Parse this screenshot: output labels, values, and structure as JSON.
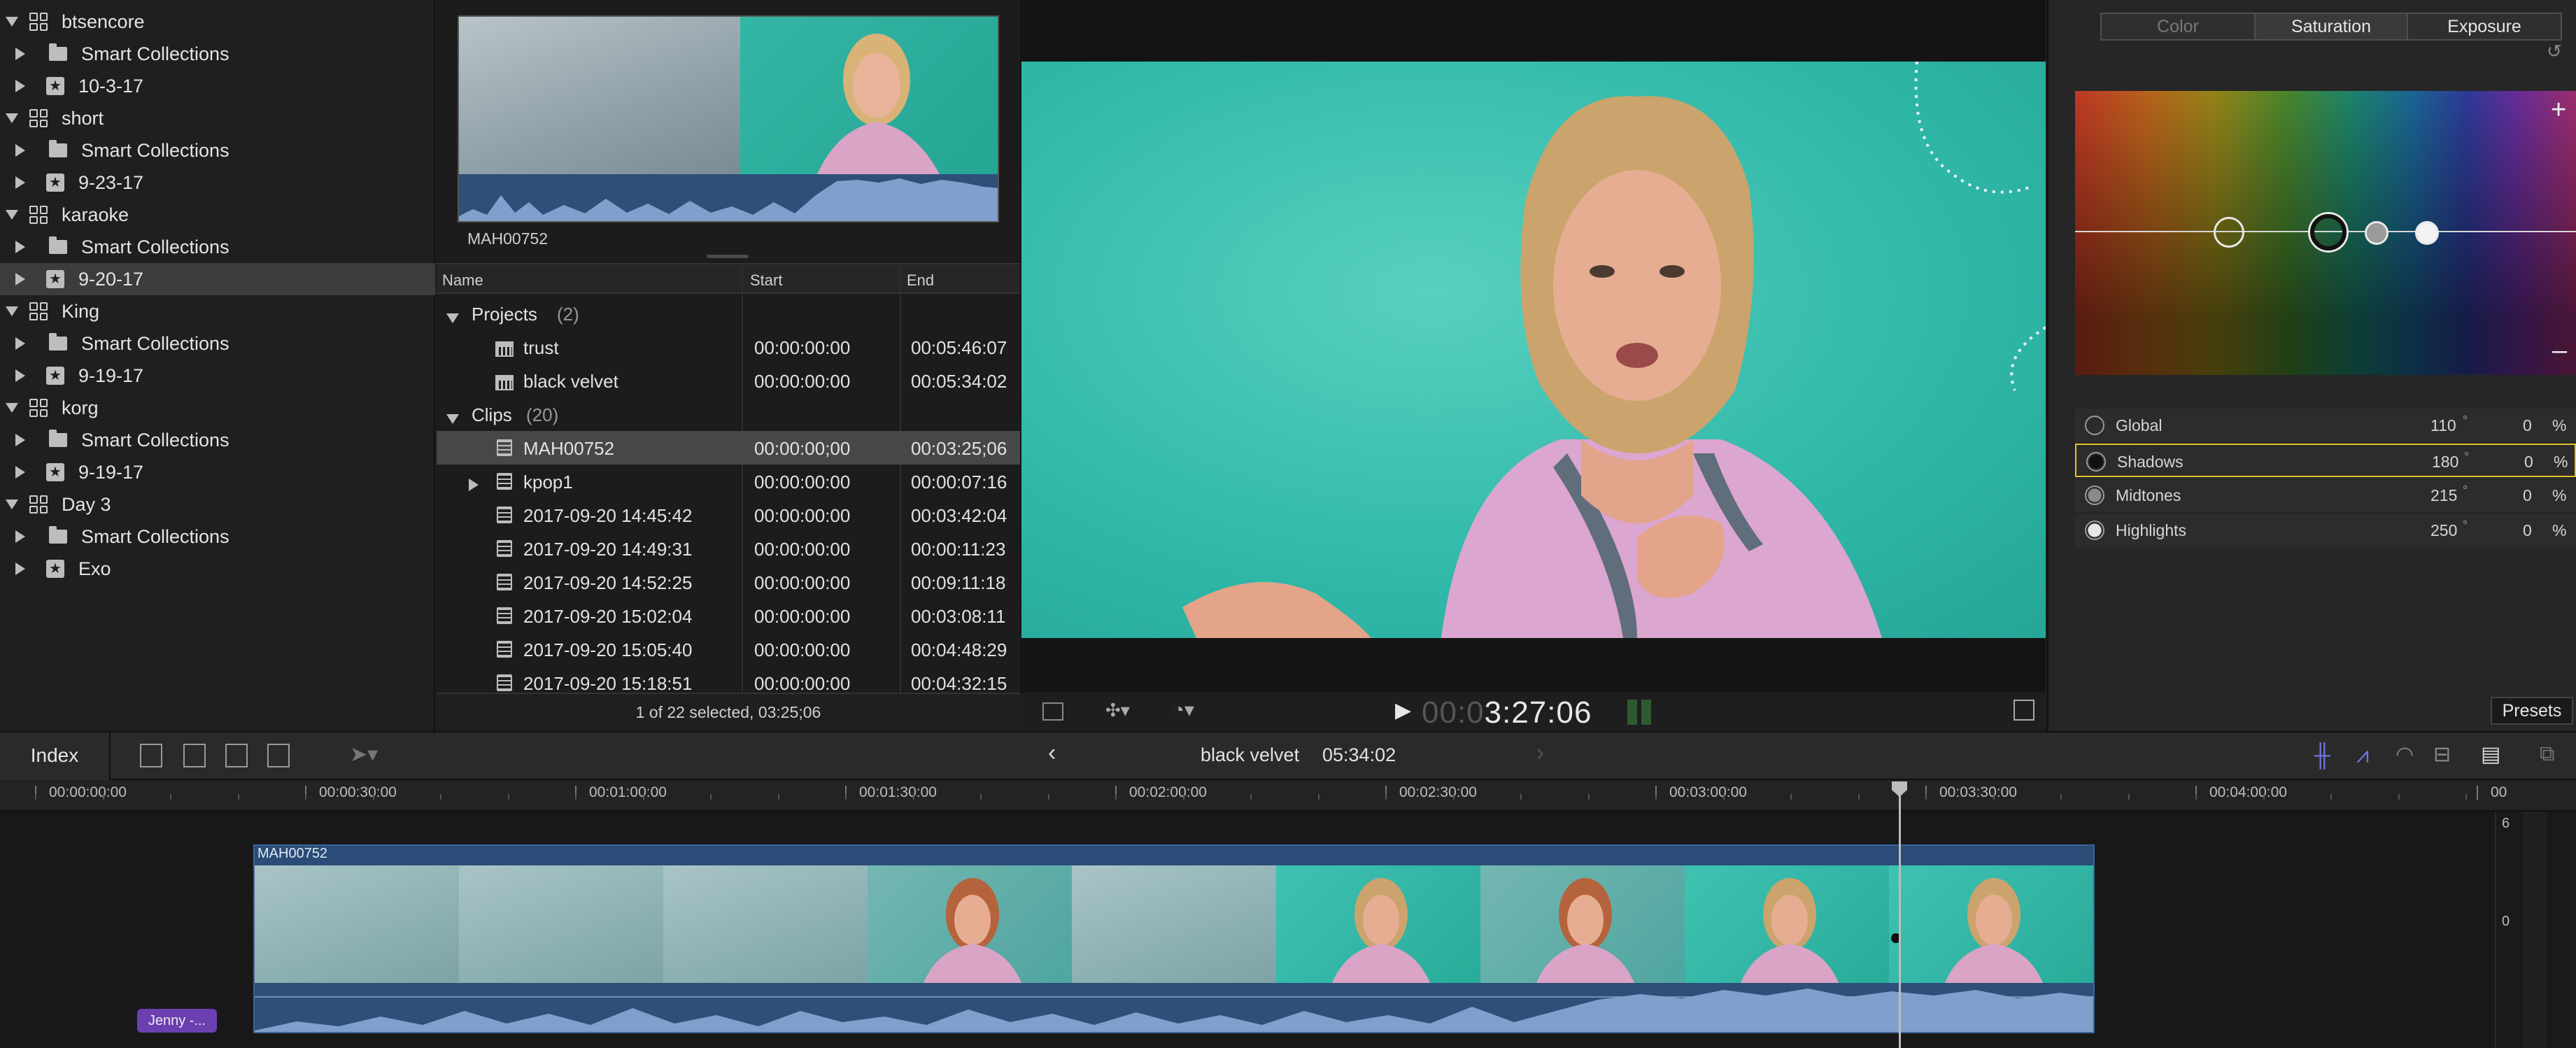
{
  "libraries": [
    {
      "label": "btsencore",
      "type": "library",
      "expanded": true
    },
    {
      "label": "Smart Collections",
      "type": "folder"
    },
    {
      "label": "10-3-17",
      "type": "event"
    },
    {
      "label": "short",
      "type": "library",
      "expanded": true
    },
    {
      "label": "Smart Collections",
      "type": "folder"
    },
    {
      "label": "9-23-17",
      "type": "event"
    },
    {
      "label": "karaoke",
      "type": "library",
      "expanded": true
    },
    {
      "label": "Smart Collections",
      "type": "folder"
    },
    {
      "label": "9-20-17",
      "type": "event",
      "selected": true
    },
    {
      "label": "King",
      "type": "library",
      "expanded": true
    },
    {
      "label": "Smart Collections",
      "type": "folder"
    },
    {
      "label": "9-19-17",
      "type": "event"
    },
    {
      "label": "korg",
      "type": "library",
      "expanded": true
    },
    {
      "label": "Smart Collections",
      "type": "folder"
    },
    {
      "label": "9-19-17",
      "type": "event"
    },
    {
      "label": "Day 3",
      "type": "library",
      "expanded": true
    },
    {
      "label": "Smart Collections",
      "type": "folder"
    },
    {
      "label": "Exo",
      "type": "event"
    }
  ],
  "browser": {
    "filmstrip_label": "MAH00752",
    "columns": [
      "Name",
      "Start",
      "End"
    ],
    "groups": [
      {
        "label": "Projects",
        "count": "(2)"
      },
      {
        "label": "Clips",
        "count": "(20)"
      }
    ],
    "project_rows": [
      {
        "name": "trust",
        "start": "00:00:00:00",
        "end": "00:05:46:07"
      },
      {
        "name": "black velvet",
        "start": "00:00:00:00",
        "end": "00:05:34:02"
      }
    ],
    "clip_rows": [
      {
        "name": "MAH00752",
        "start": "00:00:00;00",
        "end": "00:03:25;06",
        "selected": true
      },
      {
        "name": "kpop1",
        "start": "00:00:00:00",
        "end": "00:00:07:16",
        "expandable": true
      },
      {
        "name": "2017-09-20 14:45:42",
        "start": "00:00:00:00",
        "end": "00:03:42:04"
      },
      {
        "name": "2017-09-20 14:49:31",
        "start": "00:00:00:00",
        "end": "00:00:11:23"
      },
      {
        "name": "2017-09-20 14:52:25",
        "start": "00:00:00:00",
        "end": "00:09:11:18"
      },
      {
        "name": "2017-09-20 15:02:04",
        "start": "00:00:00:00",
        "end": "00:03:08:11"
      },
      {
        "name": "2017-09-20 15:05:40",
        "start": "00:00:00:00",
        "end": "00:04:48:29"
      },
      {
        "name": "2017-09-20 15:18:51",
        "start": "00:00:00:00",
        "end": "00:04:32:15"
      }
    ],
    "footer": "1 of 22 selected, 03:25;06"
  },
  "viewer": {
    "timecode_dim": "00:0",
    "timecode": "3:27:06"
  },
  "inspector": {
    "tabs": [
      "Color",
      "Saturation",
      "Exposure"
    ],
    "active_tab": "Saturation",
    "plus": "+",
    "minus": "–",
    "controls": [
      {
        "label": "Global",
        "angle": "110",
        "deg": "°",
        "value": "0",
        "unit": "%"
      },
      {
        "label": "Shadows",
        "angle": "180",
        "deg": "°",
        "value": "0",
        "unit": "%",
        "selected": true
      },
      {
        "label": "Midtones",
        "angle": "215",
        "deg": "°",
        "value": "0",
        "unit": "%"
      },
      {
        "label": "Highlights",
        "angle": "250",
        "deg": "°",
        "value": "0",
        "unit": "%"
      }
    ],
    "presets": "Presets"
  },
  "timeline": {
    "index_label": "Index",
    "project_name": "black velvet",
    "duration": "05:34:02",
    "ruler": [
      "00:00:00:00",
      "00:00:30:00",
      "00:01:00:00",
      "00:01:30:00",
      "00:02:00:00",
      "00:02:30:00",
      "00:03:00:00",
      "00:03:30:00",
      "00:04:00:00",
      "00"
    ],
    "clip_name": "MAH00752",
    "connected_clip": "Jenny -...",
    "meter": [
      "6",
      "0"
    ]
  },
  "colors": {
    "accent": "#e5c22a",
    "audio": "#2d4f78",
    "connected": "#6a3fb0"
  }
}
